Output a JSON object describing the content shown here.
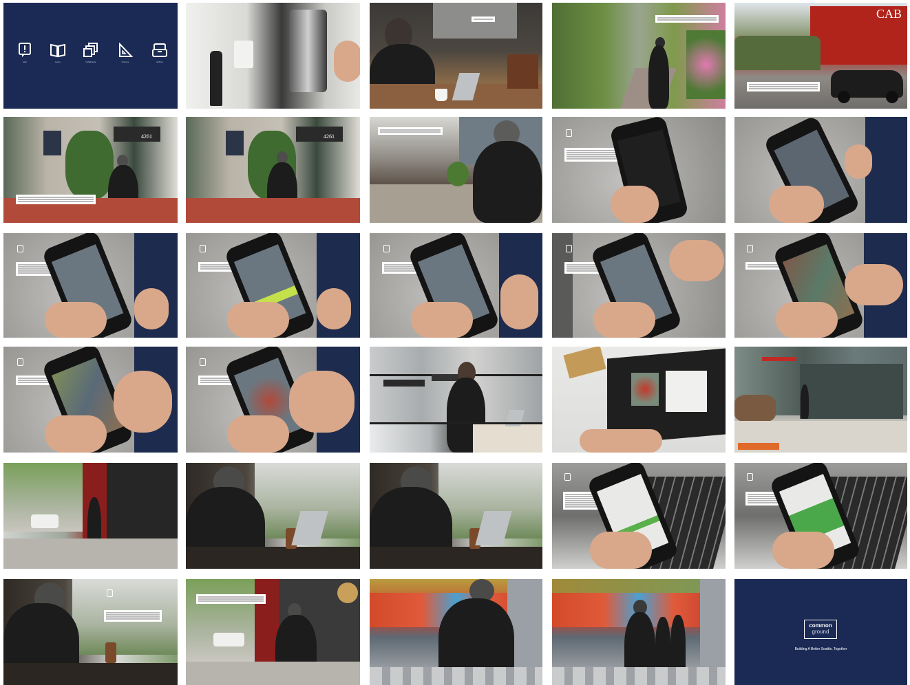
{
  "title_slide": {
    "icons": [
      {
        "name": "alert-icon",
        "label": "Alert"
      },
      {
        "name": "learn-icon",
        "label": "Learn"
      },
      {
        "name": "collaborate-icon",
        "label": "Collaborate"
      },
      {
        "name": "improve-icon",
        "label": "Improve"
      },
      {
        "name": "archive-icon",
        "label": "Archive"
      }
    ],
    "background_color": "#1b2a55"
  },
  "end_slide": {
    "logo_line1": "common",
    "logo_line2": "ground",
    "tagline": "Building A Better Seattle, Together",
    "background_color": "#1b2a55"
  },
  "scene_text": {
    "cabin_sign": "CAB",
    "building_number": "4261",
    "building_number_2": "4261"
  }
}
